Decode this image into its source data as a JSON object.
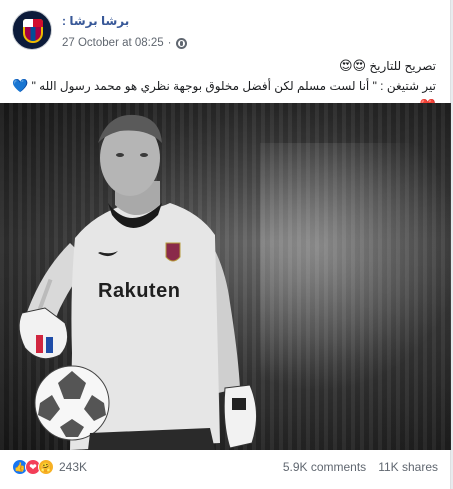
{
  "post": {
    "page_name": "برشا برشا :",
    "timestamp": "27 October at 08:25",
    "separator": "·",
    "privacy_icon": "globe-icon",
    "more_icon": "more-options-icon",
    "line1_text": "تصريح للتاريخ",
    "line1_emoji": "😍😍",
    "line2_text": "تير شتيغن : \" أنا لست مسلم لكن أفضل مخلوق بوجهة نظري هو محمد رسول الله \"",
    "line2_emoji": "💙❤️",
    "photo_caption_jersey": "Rakuten"
  },
  "stats": {
    "reactions": [
      "like",
      "love",
      "care"
    ],
    "reaction_icons": [
      "👍",
      "❤",
      "🤗"
    ],
    "reaction_count": "243K",
    "comments": "5.9K comments",
    "shares": "11K shares"
  },
  "colors": {
    "link_blue": "#385898",
    "meta_gray": "#606770",
    "like_blue": "#1877f2",
    "love_red": "#f33e58",
    "care_yellow": "#f7b125"
  }
}
